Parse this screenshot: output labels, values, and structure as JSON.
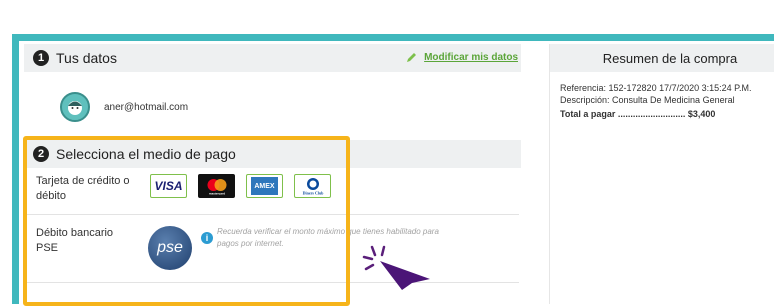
{
  "step1": {
    "number": "1",
    "title": "Tus datos",
    "modify_label": "Modificar mis datos"
  },
  "user": {
    "email": "aner@hotmail.com"
  },
  "step2": {
    "number": "2",
    "title": "Selecciona el medio de pago"
  },
  "payment_methods": [
    {
      "label_line1": "Tarjeta de crédito o",
      "label_line2": "débito",
      "cards": [
        "VISA",
        "mastercard",
        "AMEX",
        "Diners Club"
      ]
    },
    {
      "label_line1": "Débito bancario",
      "label_line2": "PSE",
      "logo_text": "pse",
      "note": "Recuerda verificar el monto máximo que tienes habilitado para pagos por internet."
    }
  ],
  "summary": {
    "title": "Resumen de la compra",
    "reference": "Referencia: 152-172820 17/7/2020 3:15:24 P.M.",
    "description": "Descripción: Consulta De Medicina General",
    "total": "Total a pagar ........................... $3,400"
  },
  "colors": {
    "teal": "#3fb8bd",
    "highlight": "#f6b41a",
    "link_green": "#5ba539",
    "info_blue": "#2c9cd2"
  },
  "icons": [
    "pencil-icon",
    "avatar-icon",
    "info-icon",
    "click-cursor-icon"
  ]
}
